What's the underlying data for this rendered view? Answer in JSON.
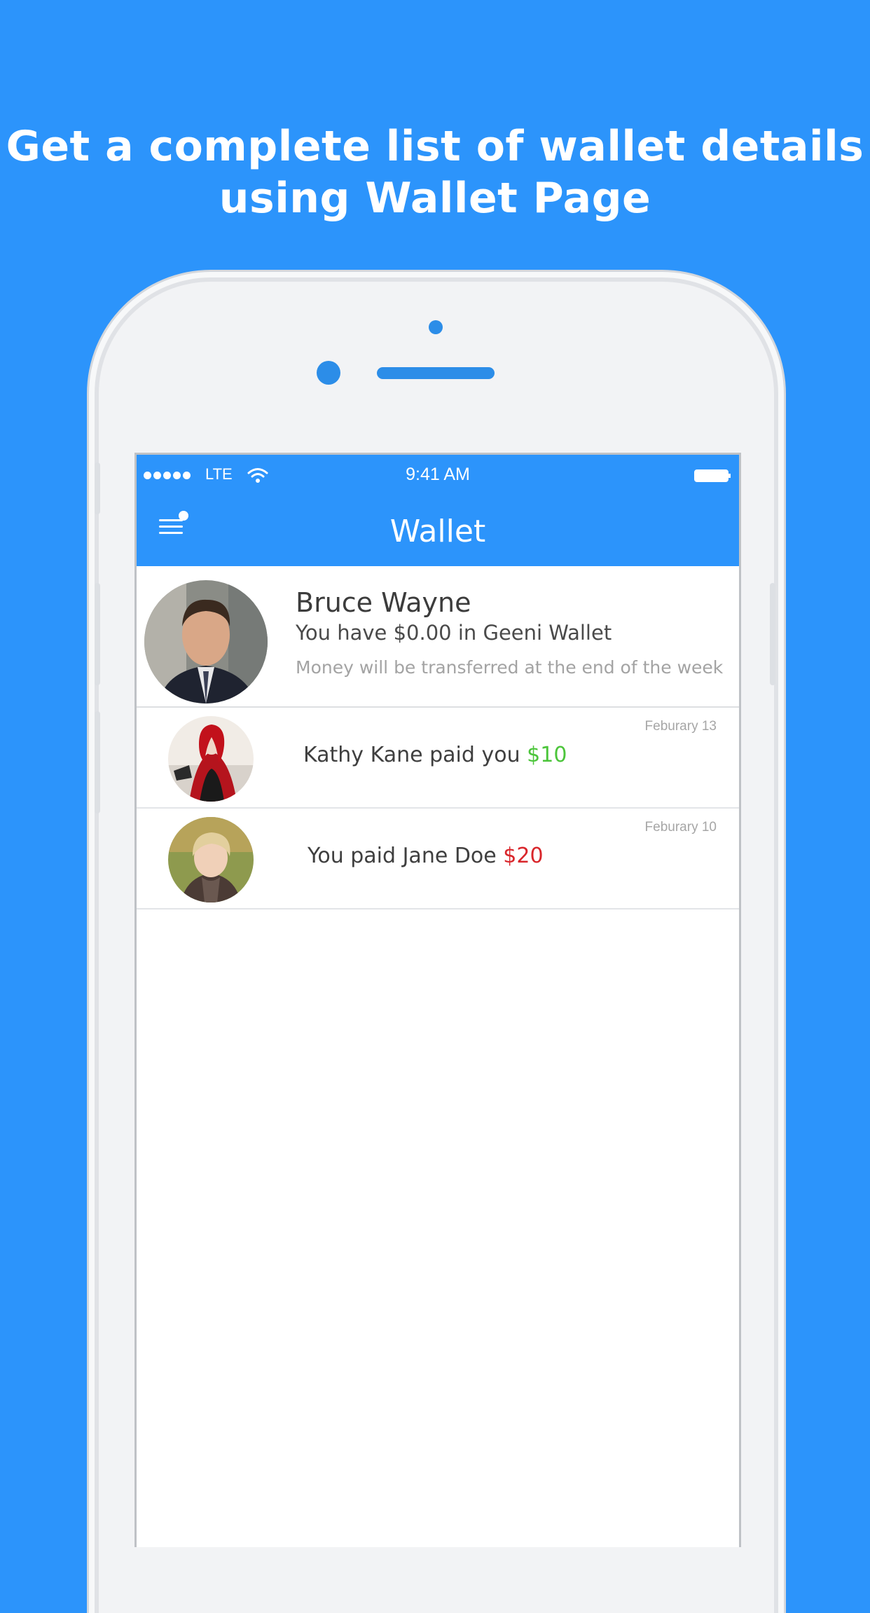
{
  "headline": {
    "line1": "Get a complete list of wallet details",
    "line2": "using Wallet Page"
  },
  "status_bar": {
    "carrier": "LTE",
    "time": "9:41 AM"
  },
  "nav": {
    "title": "Wallet"
  },
  "profile": {
    "name": "Bruce Wayne",
    "balance_text": "You have $0.00 in Geeni Wallet",
    "note": "Money will be transferred at the end of the week"
  },
  "transactions": [
    {
      "date": "Feburary 13",
      "text": "Kathy Kane paid you",
      "amount": "$10",
      "amount_color": "#4cc53b"
    },
    {
      "date": "Feburary 10",
      "text": "You paid Jane Doe",
      "amount": "$20",
      "amount_color": "#d9262b"
    }
  ],
  "colors": {
    "background": "#2c94fb",
    "nav_bar": "#2c94fb",
    "accent": "#2c8de8"
  }
}
